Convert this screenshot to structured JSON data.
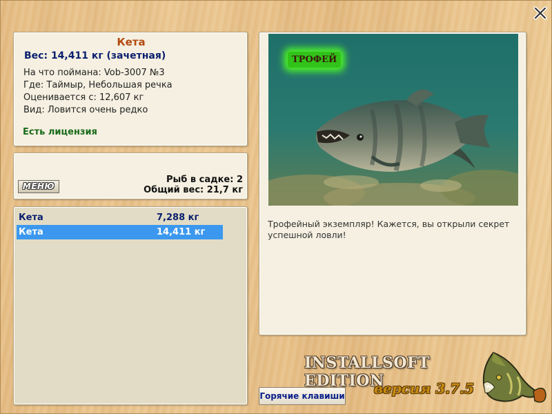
{
  "fish_info": {
    "name": "Кета",
    "weight_line": "Вес: 14,411 кг (зачетная)",
    "caught_on": "На что поймана: Vob-3007 №3",
    "location": "Где: Таймыр, Небольшая речка",
    "valued_from": "Оценивается с: 12,607 кг",
    "species_note": "Вид: Ловится очень редко",
    "license": "Есть лицензия"
  },
  "cage": {
    "menu_label": "МЕНЮ",
    "fish_count": "Рыб в садке: 2",
    "total_weight": "Общий вес: 21,7 кг"
  },
  "catch_list": [
    {
      "name": "Кета",
      "weight": "7,288 кг",
      "selected": false
    },
    {
      "name": "Кета",
      "weight": "14,411 кг",
      "selected": true
    }
  ],
  "detail": {
    "badge": "ТРОФЕЙ",
    "description": "Трофейный экземпляр! Кажется, вы открыли секрет успешной ловли!"
  },
  "hotkeys_label": "Горячие клавиши",
  "brand": {
    "name": "INSTALLSOFT EDITION",
    "version": "версия 3.7.5"
  },
  "icons": {
    "close": "close-icon",
    "logo": "pike-logo"
  }
}
